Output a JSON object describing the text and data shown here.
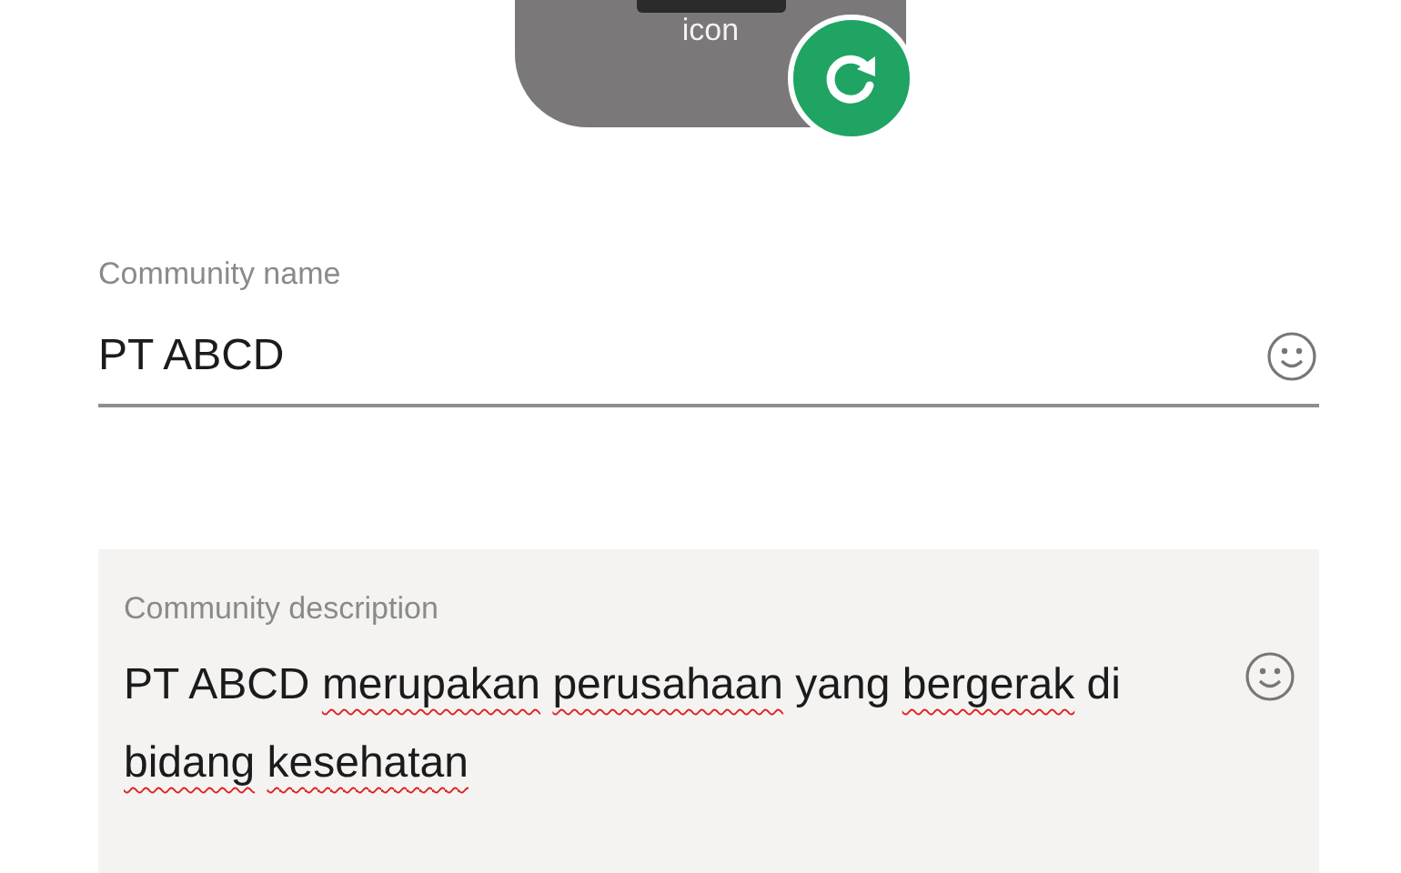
{
  "community_icon": {
    "label": "icon"
  },
  "name_field": {
    "label": "Community name",
    "value": "PT ABCD"
  },
  "description_field": {
    "label": "Community description",
    "segments": [
      {
        "text": "PT",
        "misspelled": false
      },
      {
        "text": "ABCD",
        "misspelled": false
      },
      {
        "text": "merupakan",
        "misspelled": true
      },
      {
        "text": "perusahaan",
        "misspelled": true
      },
      {
        "text": "yang",
        "misspelled": false
      },
      {
        "text": "bergerak",
        "misspelled": true
      },
      {
        "text": "di",
        "misspelled": false
      },
      {
        "text": "bidang",
        "misspelled": true
      },
      {
        "text": "kesehatan",
        "misspelled": true
      }
    ]
  }
}
